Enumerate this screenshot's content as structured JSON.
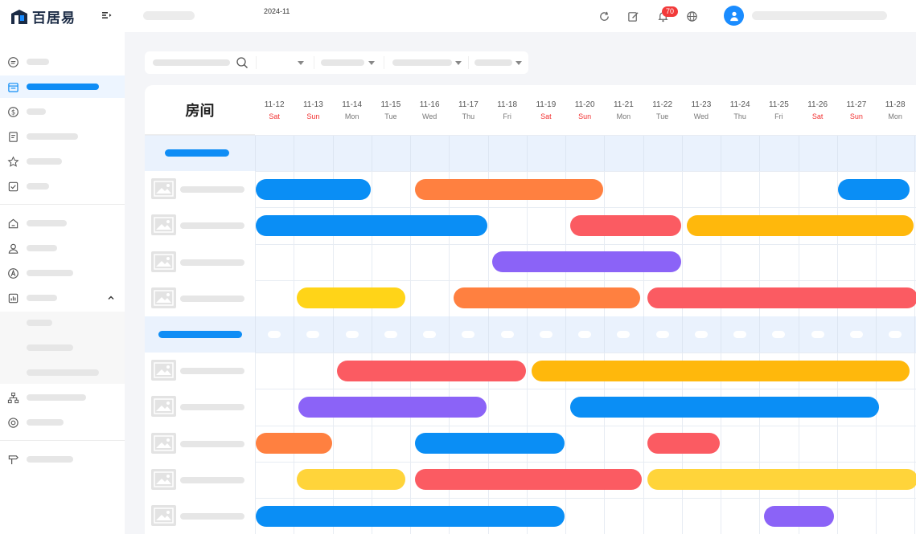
{
  "app": {
    "logo_text": "百居易"
  },
  "header": {
    "icons": [
      "refresh-icon",
      "edit-icon",
      "bell-icon",
      "globe-icon"
    ],
    "notification_count": "70"
  },
  "sidebar": {
    "items": [
      {
        "icon": "chat-icon",
        "active": false
      },
      {
        "icon": "calendar-icon",
        "active": true
      },
      {
        "icon": "dollar-icon",
        "active": false
      },
      {
        "icon": "document-icon",
        "active": false
      },
      {
        "icon": "star-icon",
        "active": false
      },
      {
        "icon": "checkbox-icon",
        "active": false
      },
      {
        "icon": "home-icon",
        "active": false
      },
      {
        "icon": "user-icon",
        "active": false
      },
      {
        "icon": "a-circle-icon",
        "active": false
      },
      {
        "icon": "bar-chart-icon",
        "active": false,
        "expanded": true
      },
      {
        "icon": "hierarchy-icon",
        "active": false
      },
      {
        "icon": "settings-icon",
        "active": false
      },
      {
        "icon": "signpost-icon",
        "active": false
      }
    ]
  },
  "filters": {
    "month": "2024-11"
  },
  "calendar": {
    "room_header": "房间",
    "days": [
      {
        "date": "11-12",
        "dow": "Sat",
        "weekend": true
      },
      {
        "date": "11-13",
        "dow": "Sun",
        "weekend": true
      },
      {
        "date": "11-14",
        "dow": "Mon",
        "weekend": false
      },
      {
        "date": "11-15",
        "dow": "Tue",
        "weekend": false
      },
      {
        "date": "11-16",
        "dow": "Wed",
        "weekend": false
      },
      {
        "date": "11-17",
        "dow": "Thu",
        "weekend": false
      },
      {
        "date": "11-18",
        "dow": "Fri",
        "weekend": false
      },
      {
        "date": "11-19",
        "dow": "Sat",
        "weekend": true
      },
      {
        "date": "11-20",
        "dow": "Sun",
        "weekend": true
      },
      {
        "date": "11-21",
        "dow": "Mon",
        "weekend": false
      },
      {
        "date": "11-22",
        "dow": "Tue",
        "weekend": false
      },
      {
        "date": "11-23",
        "dow": "Wed",
        "weekend": false
      },
      {
        "date": "11-24",
        "dow": "Thu",
        "weekend": false
      },
      {
        "date": "11-25",
        "dow": "Fri",
        "weekend": false
      },
      {
        "date": "11-26",
        "dow": "Sat",
        "weekend": true
      },
      {
        "date": "11-27",
        "dow": "Sun",
        "weekend": true
      },
      {
        "date": "11-28",
        "dow": "Mon",
        "weekend": false
      }
    ],
    "colors": {
      "blue": "#0a8ef5",
      "orange": "#ff8040",
      "red": "#fb5b62",
      "amber": "#ffb80c",
      "purple": "#8b63f7",
      "yellow": "#ffd418",
      "lightyellow": "#ffd43a"
    }
  }
}
